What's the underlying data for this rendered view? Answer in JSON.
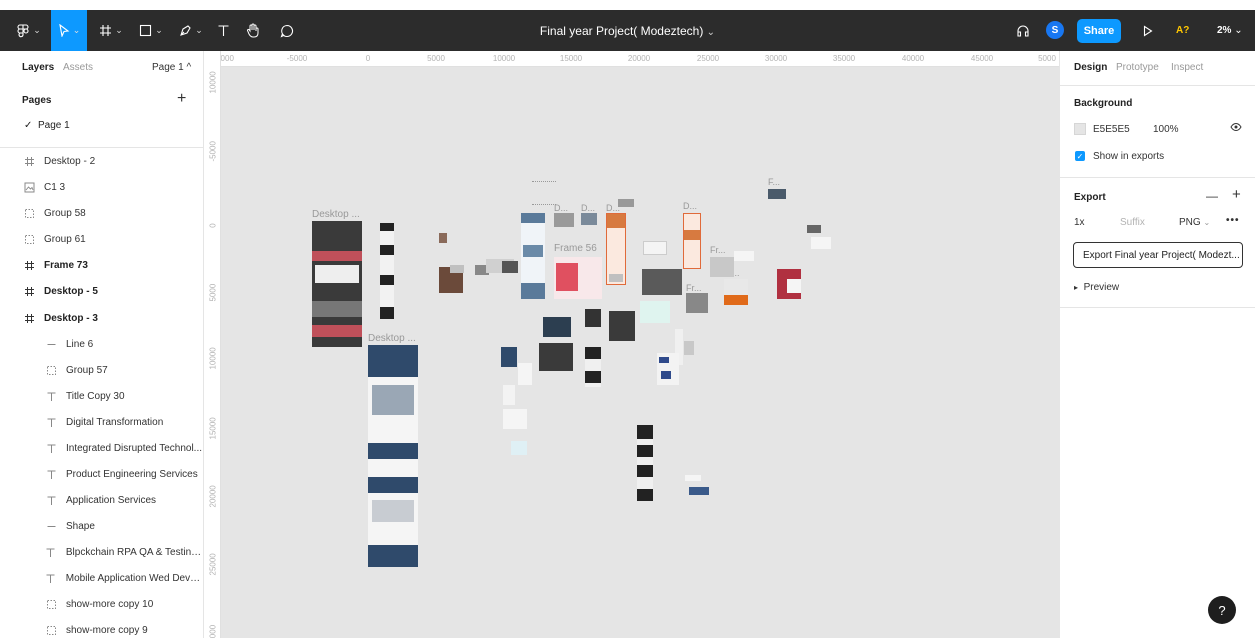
{
  "toolbar": {
    "file_title": "Final year Project( Modeztech)",
    "title_chevron": "⌄",
    "share_label": "Share",
    "avatar_initial": "S",
    "ab_test_label": "A?",
    "zoom_label": "2%",
    "zoom_chevron": "⌄",
    "icons": [
      "figma-menu-icon",
      "move-tool-icon",
      "frame-tool-icon",
      "shape-tool-icon",
      "pen-tool-icon",
      "text-tool-icon",
      "hand-tool-icon",
      "comment-tool-icon",
      "headphones-icon",
      "play-icon"
    ],
    "accent_color": "#0d99ff",
    "ab_color": "#ffc700"
  },
  "left_panel": {
    "tabs": [
      "Layers",
      "Assets"
    ],
    "page_selector": "Page 1 ^",
    "pages_title": "Pages",
    "pages_add": "+",
    "current_page": "Page 1",
    "check": "✓",
    "layers": [
      {
        "label": "Desktop - 2",
        "icon": "frame-icon",
        "bold": false
      },
      {
        "label": "C1 3",
        "icon": "image-icon",
        "bold": false
      },
      {
        "label": "Group 58",
        "icon": "group-icon",
        "bold": false
      },
      {
        "label": "Group 61",
        "icon": "group-icon",
        "bold": false
      },
      {
        "label": "Frame 73",
        "icon": "frame-icon",
        "bold": true
      },
      {
        "label": "Desktop - 5",
        "icon": "frame-icon",
        "bold": true
      },
      {
        "label": "Desktop - 3",
        "icon": "frame-icon",
        "bold": true
      },
      {
        "label": "Line 6",
        "icon": "line-icon",
        "bold": false
      },
      {
        "label": "Group 57",
        "icon": "group-icon",
        "bold": false
      },
      {
        "label": "Title Copy 30",
        "icon": "text-icon",
        "bold": false
      },
      {
        "label": "Digital Transformation",
        "icon": "text-icon",
        "bold": false
      },
      {
        "label": "Integrated Disrupted Technol...",
        "icon": "text-icon",
        "bold": false
      },
      {
        "label": "Product Engineering Services",
        "icon": "text-icon",
        "bold": false
      },
      {
        "label": "Application Services",
        "icon": "text-icon",
        "bold": false
      },
      {
        "label": "Shape",
        "icon": "line-icon",
        "bold": false
      },
      {
        "label": "Blpckchain RPA QA & Testing...",
        "icon": "text-icon",
        "bold": false
      },
      {
        "label": "Mobile Application Wed Devel...",
        "icon": "text-icon",
        "bold": false
      },
      {
        "label": "show-more copy 10",
        "icon": "group-icon",
        "bold": false
      },
      {
        "label": "show-more copy 9",
        "icon": "group-icon",
        "bold": false
      }
    ]
  },
  "canvas": {
    "background_color": "#e5e5e5",
    "ruler_top": [
      "0000",
      "-5000",
      "0",
      "5000",
      "10000",
      "15000",
      "20000",
      "25000",
      "30000",
      "35000",
      "40000",
      "45000",
      "5000"
    ],
    "ruler_left": [
      "10000",
      "-5000",
      "0",
      "5000",
      "10000",
      "15000",
      "20000",
      "25000",
      "000"
    ],
    "frame_labels": [
      "Desktop ...",
      "Desktop ...",
      "Frame 56",
      "D...",
      "D...",
      "D...",
      "D...",
      "F...",
      "Fr...",
      "Fr...",
      "Fr..."
    ]
  },
  "right_panel": {
    "tabs": [
      "Design",
      "Prototype",
      "Inspect"
    ],
    "background_title": "Background",
    "bg_hex": "E5E5E5",
    "bg_opacity": "100%",
    "show_in_exports": "Show in exports",
    "export_title": "Export",
    "export_minus": "—",
    "export_plus": "+",
    "export_scale": "1x",
    "export_suffix_placeholder": "Suffix",
    "export_format": "PNG",
    "export_more": "•••",
    "export_button": "Export Final year Project( Modezt...",
    "preview_label": "Preview",
    "preview_arrow": "▸"
  },
  "help_label": "?"
}
